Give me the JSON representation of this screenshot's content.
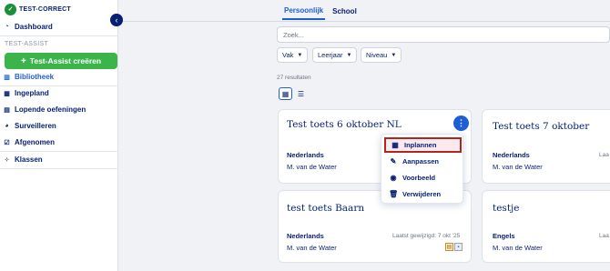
{
  "logo": {
    "text": "TEST-CORRECT",
    "badge": "tc"
  },
  "collapse_glyph": "‹",
  "sidebar": {
    "dashboard": "Dashboard",
    "section_label": "TEST-ASSIST",
    "create_button": "Test-Assist creëren",
    "items": [
      {
        "label": "Bibliotheek",
        "icon": "library-icon",
        "active": true
      },
      {
        "label": "Ingepland",
        "icon": "calendar-icon"
      },
      {
        "label": "Lopende oefeningen",
        "icon": "running-exercises-icon"
      },
      {
        "label": "Surveilleren",
        "icon": "surveillance-icon"
      },
      {
        "label": "Afgenomen",
        "icon": "taken-icon"
      },
      {
        "label": "Klassen",
        "icon": "classes-icon"
      }
    ]
  },
  "tabs": [
    {
      "label": "Persoonlijk",
      "active": true
    },
    {
      "label": "School"
    }
  ],
  "search": {
    "placeholder": "Zoek..."
  },
  "filters": [
    "Vak",
    "Leerjaar",
    "Niveau"
  ],
  "results_text": "27 resultaten",
  "cards": [
    {
      "title": "Test toets 6 oktober NL",
      "subject": "Nederlands",
      "author": "M. van de Water"
    },
    {
      "title": "Test toets 7 oktober",
      "subject": "Nederlands",
      "author": "M. van de Water",
      "date_fragment": "Laa"
    },
    {
      "title": "test toets Baarn",
      "subject": "Nederlands",
      "author": "M. van de Water",
      "date": "Laatst gewijzigd: 7 okt '25"
    },
    {
      "title": "testje",
      "subject": "Engels",
      "author": "M. van de Water",
      "date_fragment": "Laa"
    }
  ],
  "menu": {
    "items": [
      {
        "label": "Inplannen",
        "icon": "calendar-icon",
        "highlighted": true
      },
      {
        "label": "Aanpassen",
        "icon": "pencil-icon"
      },
      {
        "label": "Voorbeeld",
        "icon": "eye-icon"
      },
      {
        "label": "Verwijderen",
        "icon": "trash-icon"
      }
    ]
  },
  "colors": {
    "brand_navy": "#041f74",
    "accent_blue": "#1f5fd6",
    "create_green": "#3bb54a",
    "highlight_red": "#b3261e"
  }
}
